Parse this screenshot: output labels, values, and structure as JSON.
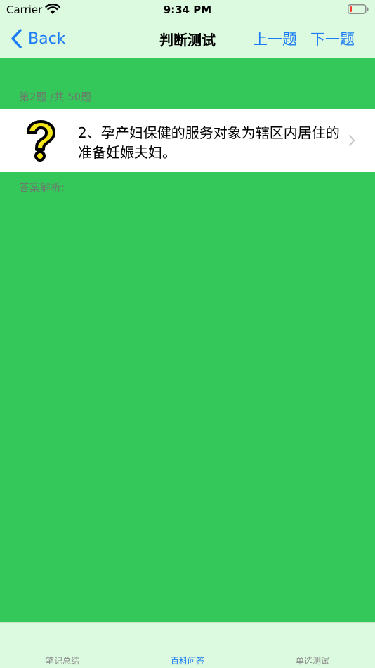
{
  "status_bar": {
    "carrier": "Carrier",
    "time": "9:34 PM"
  },
  "nav": {
    "back_label": "Back",
    "title": "判断测试",
    "prev_label": "上一题",
    "next_label": "下一题"
  },
  "question": {
    "counter": "第2题 /共 50题",
    "text": "2、孕产妇保健的服务对象为辖区内居住的准备妊娠夫妇。",
    "analysis_label": "答案解析:"
  },
  "tabs": [
    {
      "label": "笔记总结",
      "active": false
    },
    {
      "label": "百科问答",
      "active": true
    },
    {
      "label": "单选测试",
      "active": false
    }
  ],
  "colors": {
    "accent": "#1a7cf5",
    "content_bg": "#34c75a",
    "bar_bg": "#dcfadf",
    "battery_level": "#ff3b30"
  }
}
